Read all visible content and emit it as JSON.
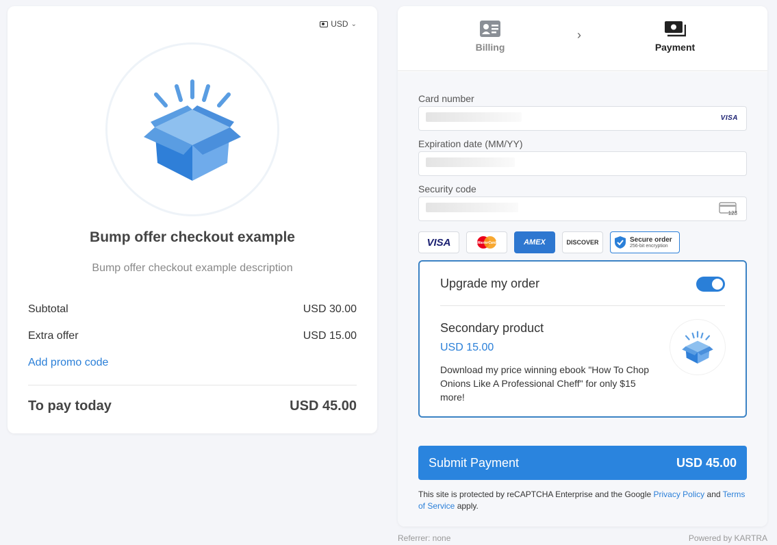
{
  "currency": {
    "label": "USD"
  },
  "product": {
    "title": "Bump offer checkout example",
    "description": "Bump offer checkout example description"
  },
  "summary": {
    "rows": [
      {
        "label": "Subtotal",
        "value": "USD 30.00"
      },
      {
        "label": "Extra offer",
        "value": "USD 15.00"
      }
    ],
    "promo_label": "Add promo code",
    "total_label": "To pay today",
    "total_value": "USD 45.00"
  },
  "steps": {
    "billing": "Billing",
    "payment": "Payment"
  },
  "form": {
    "card_number_label": "Card number",
    "expiration_label": "Expiration date (MM/YY)",
    "security_label": "Security code",
    "visa_mini": "VISA",
    "cvc_hint": "123"
  },
  "brands": {
    "visa": "VISA",
    "mastercard": "MasterCard",
    "amex": "AMEX",
    "discover": "DISCOVER",
    "secure_title": "Secure order",
    "secure_sub": "256-bit encryption"
  },
  "upgrade": {
    "title": "Upgrade my order",
    "enabled": true,
    "product_name": "Secondary product",
    "price": "USD 15.00",
    "description": "Download my price winning ebook \"How To Chop Onions Like A Professional Cheff\" for only $15 more!"
  },
  "submit": {
    "label": "Submit Payment",
    "amount": "USD 45.00"
  },
  "recaptcha": {
    "prefix": "This site is protected by reCAPTCHA Enterprise and the Google ",
    "privacy": "Privacy Policy",
    "and": " and ",
    "terms": "Terms of Service",
    "suffix": " apply."
  },
  "footer": {
    "referrer": "Referrer: none",
    "powered": "Powered by KARTRA"
  },
  "colors": {
    "accent": "#2a84de",
    "border_highlight": "#3b82c4",
    "box_blue": "#3b8be0"
  }
}
